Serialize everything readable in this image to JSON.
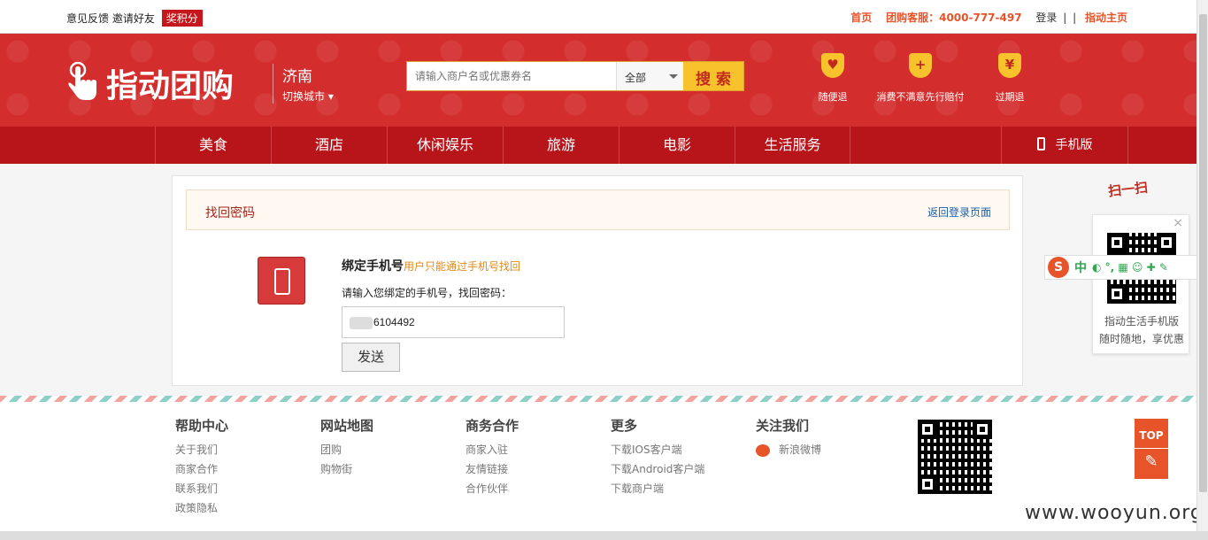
{
  "topbar": {
    "feedback": "意见反馈",
    "invite": "邀请好友",
    "reward_badge": "奖积分",
    "home": "首页",
    "hotline": "团购客服：4000-777-497",
    "login": "登录",
    "sep": "|",
    "sep2": "|",
    "main_site": "指动主页"
  },
  "header": {
    "logo_text": "指动团购",
    "city": "济南",
    "switch_city": "切换城市 ▾",
    "search_placeholder": "请输入商户名或优惠券名",
    "search_scope": "全部",
    "search_button": "搜 索",
    "promises": [
      {
        "icon": "heart-shield-icon",
        "label": "随便退",
        "glyph": "♥"
      },
      {
        "icon": "plus-shield-icon",
        "label": "消费不满意先行赔付",
        "glyph": "+"
      },
      {
        "icon": "yen-shield-icon",
        "label": "过期退",
        "glyph": "¥"
      }
    ]
  },
  "nav": {
    "items": [
      "美食",
      "酒店",
      "休闲娱乐",
      "旅游",
      "电影",
      "生活服务"
    ],
    "mobile": "手机版"
  },
  "recover": {
    "title": "找回密码",
    "back_link": "返回登录页面",
    "bind_title": "绑定手机号",
    "bind_hint": "用户只能通过手机号找回",
    "input_label": "请输入您绑定的手机号，找回密码：",
    "phone_value": "6104492",
    "send_button": "发送"
  },
  "footer": {
    "columns": [
      {
        "heading": "帮助中心",
        "links": [
          "关于我们",
          "商家合作",
          "联系我们",
          "政策隐私"
        ]
      },
      {
        "heading": "网站地图",
        "links": [
          "团购",
          "购物街"
        ]
      },
      {
        "heading": "商务合作",
        "links": [
          "商家入驻",
          "友情链接",
          "合作伙伴"
        ]
      },
      {
        "heading": "更多",
        "links": [
          "下载IOS客户端",
          "下载Android客户端",
          "下载商户端"
        ]
      },
      {
        "heading": "关注我们",
        "links": [
          "新浪微博"
        ]
      }
    ],
    "top_button": "TOP"
  },
  "side_panel": {
    "scan_label": "扫一扫",
    "close": "×",
    "line1": "指动生活手机版",
    "line2": "随时随地，享优惠"
  },
  "ime_bar": {
    "logo": "S",
    "mode": "中",
    "glyphs": "◐ °, ▦ ☺ ✚ ✎"
  },
  "watermark": "www.wooyun.org",
  "colors": {
    "brand_red": "#d42d2d",
    "nav_red": "#b8151b",
    "accent_yellow": "#f8c22d",
    "link_blue": "#1b5ea6"
  }
}
